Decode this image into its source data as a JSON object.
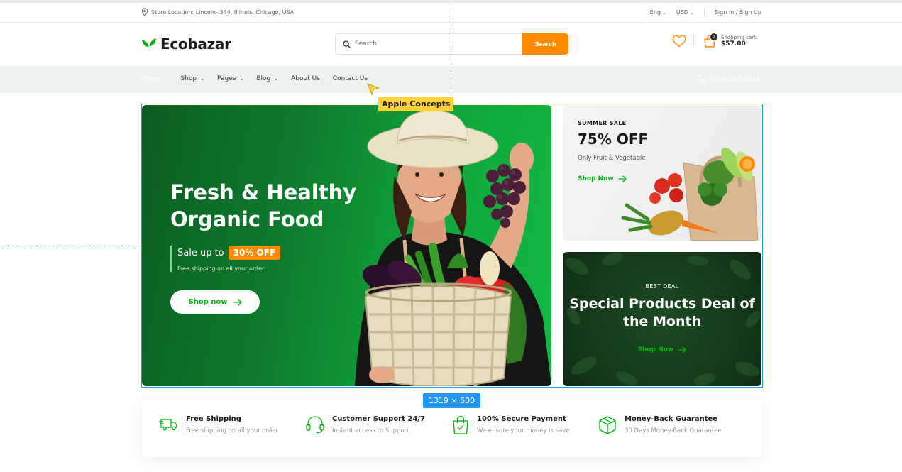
{
  "topbar": {
    "location": "Store Location: Lincoln- 344, Illinois, Chicago, USA",
    "language": "Eng",
    "currency": "USD",
    "sign_in": "Sign In",
    "slash": "/",
    "sign_up": "Sign Up"
  },
  "header": {
    "logo": "Ecobazar",
    "search_placeholder": "Search",
    "search_button": "Search",
    "cart_count": "2",
    "cart_label": "Shopping cart:",
    "cart_total": "$57.00"
  },
  "nav": {
    "items": [
      "Home",
      "Shop",
      "Pages",
      "Blog",
      "About Us",
      "Contact Us"
    ],
    "phone": "(219) 555-0114"
  },
  "overlay": {
    "concept_label": "Apple Concepts",
    "size_label": "1319 × 600"
  },
  "hero": {
    "title": "Fresh & Healthy Organic Food",
    "sale_text": "Sale up to",
    "sale_badge": "30% OFF",
    "sale_sub": "Free shipping on all your order.",
    "button": "Shop now"
  },
  "summer_sale": {
    "label": "SUMMER SALE",
    "title": "75% OFF",
    "subtitle": "Only Fruit & Vegetable",
    "link": "Shop Now"
  },
  "best_deal": {
    "label": "BEST DEAL",
    "title": "Special Products Deal of the Month",
    "link": "Shop Now"
  },
  "features": [
    {
      "title": "Free Shipping",
      "subtitle": "Free shipping on all your order",
      "icon": "truck-icon"
    },
    {
      "title": "Customer Support 24/7",
      "subtitle": "Instant access to Support",
      "icon": "headphones-icon"
    },
    {
      "title": "100% Secure Payment",
      "subtitle": "We ensure your money is save",
      "icon": "shopping-bag-icon"
    },
    {
      "title": "Money-Back Guarantee",
      "subtitle": "30 Days Money-Back Guarantee",
      "icon": "package-icon"
    }
  ],
  "colors": {
    "brand_green": "#00b207",
    "accent_orange": "#ff8a00",
    "nav_bg": "#edf2ee",
    "guide_blue": "#2196f3"
  }
}
